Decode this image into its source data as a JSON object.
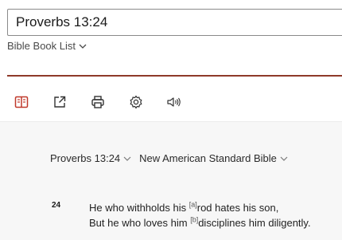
{
  "search": {
    "value": "Proverbs 13:24"
  },
  "book_list": {
    "label": "Bible Book List"
  },
  "toolbar": {
    "icons": [
      "parallel-view-icon",
      "open-new-window-icon",
      "print-icon",
      "settings-gear-icon",
      "audio-speaker-icon"
    ]
  },
  "passage": {
    "reference": "Proverbs 13:24",
    "version": "New American Standard Bible",
    "verse_number": "24",
    "line1_before": "He who withholds his ",
    "line1_footnote": "[a]",
    "line1_after": "rod hates his son,",
    "line2_before": "But he who loves him ",
    "line2_footnote": "[b]",
    "line2_after": "disciplines him diligently."
  },
  "colors": {
    "accent_red": "#c0392b",
    "rule": "#8f3a2a"
  }
}
